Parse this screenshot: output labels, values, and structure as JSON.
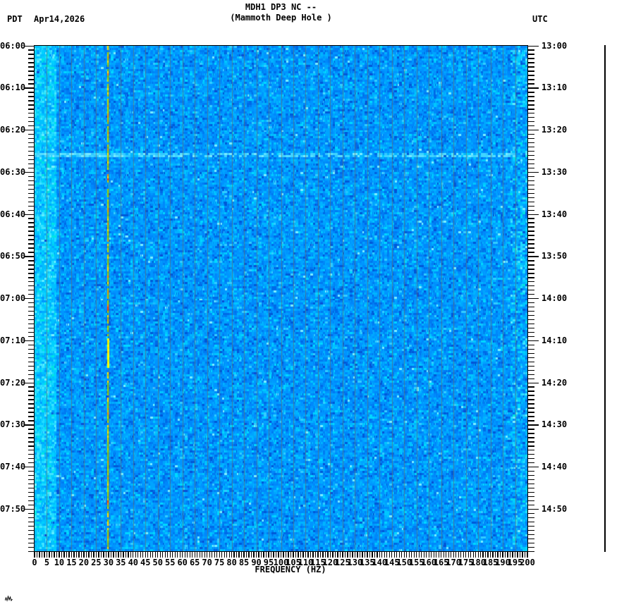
{
  "header": {
    "tz_left_label": "PDT",
    "date_label": "Apr14,2026",
    "title": "MDH1 DP3 NC --",
    "subtitle": "(Mammoth Deep Hole )",
    "tz_right_label": "UTC"
  },
  "left_axis": {
    "timezone": "PDT",
    "labels": [
      "06:00",
      "06:10",
      "06:20",
      "06:30",
      "06:40",
      "06:50",
      "07:00",
      "07:10",
      "07:20",
      "07:30",
      "07:40",
      "07:50"
    ],
    "label_step_minutes": 10,
    "minor_tick_step_minutes": 1,
    "span_minutes": 120
  },
  "right_axis": {
    "timezone": "UTC",
    "labels": [
      "13:00",
      "13:10",
      "13:20",
      "13:30",
      "13:40",
      "13:50",
      "14:00",
      "14:10",
      "14:20",
      "14:30",
      "14:40",
      "14:50"
    ],
    "label_step_minutes": 10,
    "minor_tick_step_minutes": 1,
    "span_minutes": 120
  },
  "x_axis": {
    "label": "FREQUENCY (HZ)",
    "min_hz": 0,
    "max_hz": 200,
    "minor_tick_step_hz": 1,
    "labeled_ticks": [
      "0",
      "5",
      "10",
      "15",
      "20",
      "25",
      "30",
      "35",
      "40",
      "45",
      "50",
      "55",
      "60",
      "65",
      "70",
      "75",
      "80",
      "85",
      "90",
      "95",
      "100",
      "105",
      "110",
      "115",
      "120",
      "125",
      "130",
      "135",
      "140",
      "145",
      "150",
      "155",
      "160",
      "165",
      "170",
      "175",
      "180",
      "185",
      "190",
      "195",
      "200"
    ]
  },
  "scale_bar": {
    "description": "vertical amplitude scale bar right of plot",
    "event_marker_fraction": 0.216
  },
  "corner_mark": {
    "icon": "tiny-squiggle-icon"
  },
  "chart_data": {
    "type": "heatmap",
    "subtype": "seismic-spectrogram",
    "title": "MDH1 DP3 NC --",
    "subtitle": "(Mammoth Deep Hole )",
    "xlabel": "FREQUENCY (HZ)",
    "x_range_hz": [
      0,
      200
    ],
    "time_range_left_pdt": [
      "06:00",
      "08:00"
    ],
    "time_range_right_utc": [
      "13:00",
      "15:00"
    ],
    "date": "Apr14,2026",
    "grid": "faint vertical gridlines every 5 Hz",
    "legend_position": "none",
    "features": [
      {
        "name": "broadband_background_noise",
        "freq_hz": [
          0,
          200
        ],
        "description": "mottled blue field over full duration"
      },
      {
        "name": "low_frequency_energy_band",
        "freq_hz": [
          0,
          9
        ],
        "description": "brighter cyan column at left edge, entire duration"
      },
      {
        "name": "persistent_narrowband_tone",
        "freq_hz": 29.5,
        "description": "green-yellow vertical line over entire duration",
        "bright_segment_pdt": [
          "07:10",
          "07:15"
        ]
      },
      {
        "name": "broadband_event_stripe",
        "time_pdt": "06:25",
        "time_utc": "13:25",
        "freq_hz": [
          0,
          200
        ],
        "description": "light cyan horizontal stripe, strongest below 60 Hz; matching tick on amplitude scale bar"
      },
      {
        "name": "right_edge_brightening",
        "freq_hz": [
          193,
          200
        ],
        "description": "slightly brighter cyan streaks near 195-200 Hz"
      }
    ],
    "render_palette": {
      "plot_border": "#000000",
      "gridline": "rgba(112,108,92,0.6)",
      "base": [
        [
          "#0095ff",
          10
        ],
        [
          "#0088fb",
          8
        ],
        [
          "#00a4ff",
          8
        ],
        [
          "#007bf2",
          5
        ],
        [
          "#00b4ff",
          5
        ],
        [
          "#00c6ff",
          3
        ],
        [
          "#006ae8",
          3
        ],
        [
          "#00d8ff",
          1.5
        ],
        [
          "#0059d8",
          1.5
        ],
        [
          "#33ccff",
          1
        ]
      ],
      "low_freq": [
        [
          "#00c0ff",
          8
        ],
        [
          "#00d0ff",
          6
        ],
        [
          "#20dcff",
          5
        ],
        [
          "#00aaff",
          4
        ],
        [
          "#40e4ff",
          3
        ],
        [
          "#00e4e0",
          2
        ],
        [
          "#0098ff",
          2
        ],
        [
          "#60eeff",
          1
        ]
      ],
      "event_band": [
        [
          "#40d4ff",
          6
        ],
        [
          "#58e0ff",
          5
        ],
        [
          "#30c8ff",
          4
        ],
        [
          "#78eaff",
          2
        ],
        [
          "#00b4ff",
          2
        ]
      ],
      "tone": [
        [
          "#9ed400",
          5
        ],
        [
          "#b8e000",
          4
        ],
        [
          "#7cc41c",
          3
        ],
        [
          "#ffe000",
          2
        ],
        [
          "#e0a000",
          1
        ],
        [
          "#ff8800",
          0.5
        ]
      ],
      "tone_bright": [
        [
          "#ffff00",
          6
        ],
        [
          "#ffe600",
          3
        ],
        [
          "#d8ff00",
          2
        ]
      ],
      "speckle_dark": "#0a4fd6",
      "speckle_bright": "#7ceeff"
    }
  }
}
